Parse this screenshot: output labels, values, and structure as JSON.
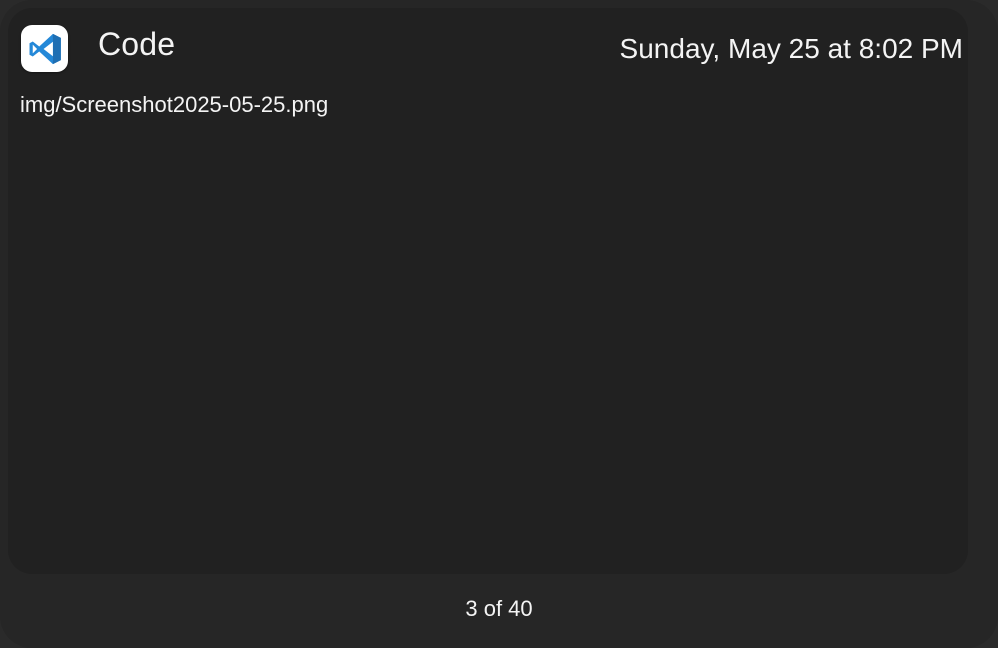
{
  "notification": {
    "app_name": "Code",
    "app_icon": "vscode-icon",
    "timestamp": "Sunday, May 25 at 8:02 PM",
    "file_path": "img/Screenshot2025-05-25.png",
    "pager": "3 of 40"
  },
  "colors": {
    "background": "#262626",
    "panel": "#212121",
    "text": "#f4f4f4",
    "vscode_blue": "#1f8ad2"
  }
}
